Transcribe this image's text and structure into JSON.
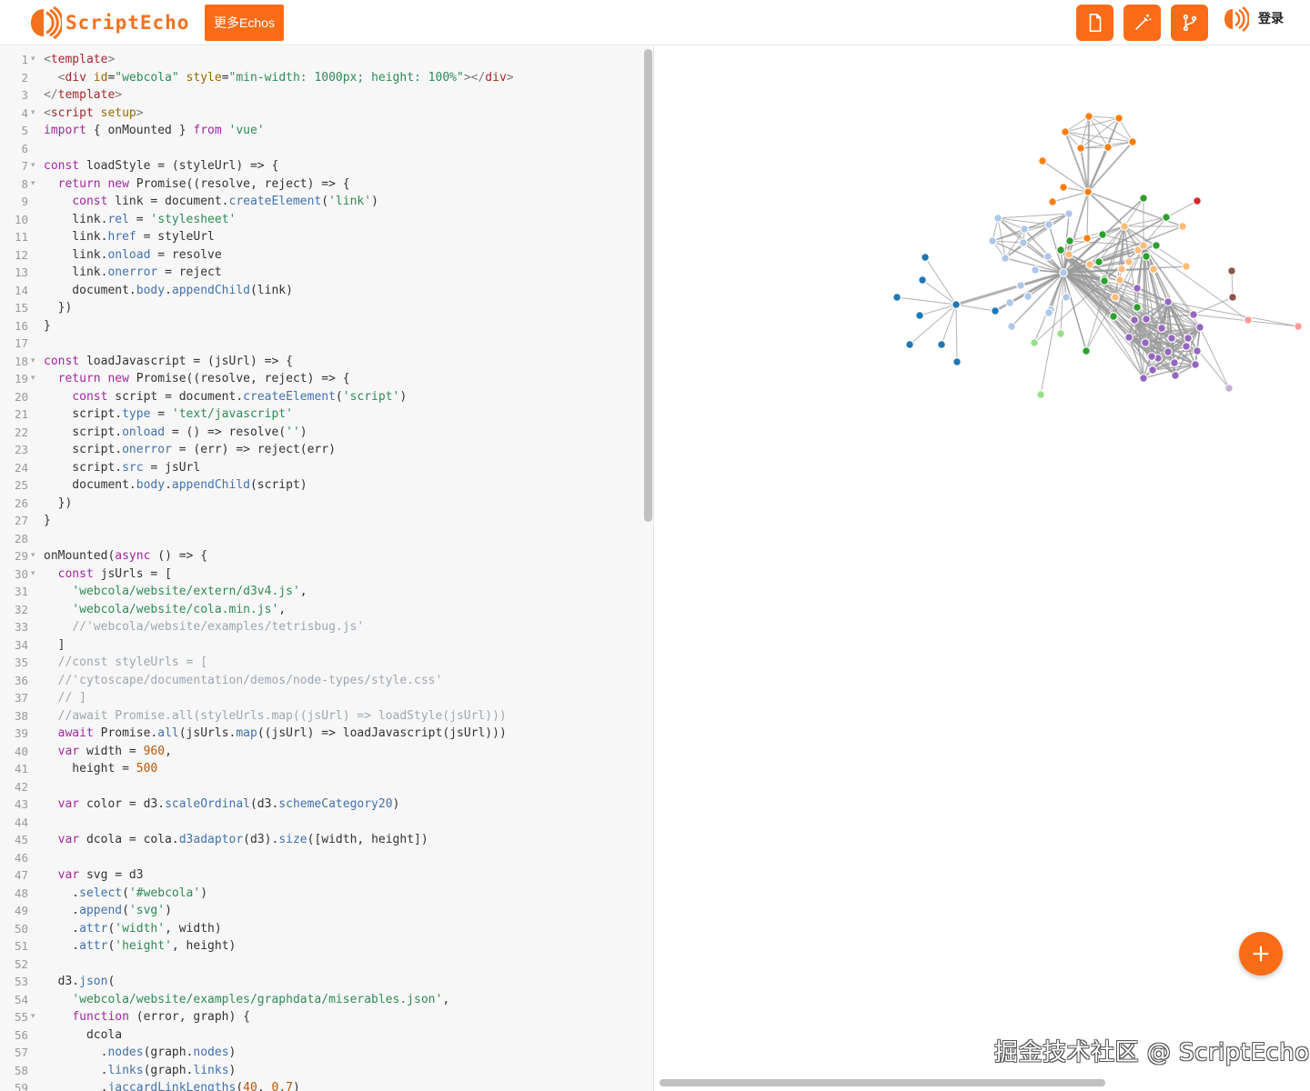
{
  "header": {
    "logo_text": "ScriptEcho",
    "more_button": "更多Echos",
    "tools": [
      {
        "icon": "file-icon"
      },
      {
        "icon": "magic-wand-icon"
      },
      {
        "icon": "branch-icon"
      }
    ],
    "login_label": "登录"
  },
  "colors": {
    "accent": "#fa6c17",
    "logo": "#f4711e"
  },
  "editor": {
    "lines": [
      [
        [
          "br",
          "<"
        ],
        [
          "tag",
          "template"
        ],
        [
          "br",
          ">"
        ]
      ],
      [
        [
          "tx",
          "  "
        ],
        [
          "br",
          "<"
        ],
        [
          "tag",
          "div"
        ],
        [
          "tx",
          " "
        ],
        [
          "attr",
          "id"
        ],
        [
          "tx",
          "="
        ],
        [
          "str",
          "\"webcola\""
        ],
        [
          "tx",
          " "
        ],
        [
          "attr",
          "style"
        ],
        [
          "tx",
          "="
        ],
        [
          "str",
          "\"min-width: 1000px; height: 100%\""
        ],
        [
          "br",
          "></"
        ],
        [
          "tag",
          "div"
        ],
        [
          "br",
          ">"
        ]
      ],
      [
        [
          "br",
          "</"
        ],
        [
          "tag",
          "template"
        ],
        [
          "br",
          ">"
        ]
      ],
      [
        [
          "br",
          "<"
        ],
        [
          "tag",
          "script"
        ],
        [
          "tx",
          " "
        ],
        [
          "attr",
          "setup"
        ],
        [
          "br",
          ">"
        ]
      ],
      [
        [
          "kw",
          "import"
        ],
        [
          "tx",
          " { onMounted } "
        ],
        [
          "kw",
          "from"
        ],
        [
          "tx",
          " "
        ],
        [
          "str",
          "'vue'"
        ]
      ],
      [],
      [
        [
          "kw",
          "const"
        ],
        [
          "tx",
          " loadStyle = (styleUrl) => {"
        ]
      ],
      [
        [
          "tx",
          "  "
        ],
        [
          "kw",
          "return"
        ],
        [
          "tx",
          " "
        ],
        [
          "kw",
          "new"
        ],
        [
          "tx",
          " Promise((resolve, reject) => {"
        ]
      ],
      [
        [
          "tx",
          "    "
        ],
        [
          "kw",
          "const"
        ],
        [
          "tx",
          " link = document."
        ],
        [
          "prop",
          "createElement"
        ],
        [
          "tx",
          "("
        ],
        [
          "str",
          "'link'"
        ],
        [
          "tx",
          ")"
        ]
      ],
      [
        [
          "tx",
          "    link."
        ],
        [
          "prop",
          "rel"
        ],
        [
          "tx",
          " = "
        ],
        [
          "str",
          "'stylesheet'"
        ]
      ],
      [
        [
          "tx",
          "    link."
        ],
        [
          "prop",
          "href"
        ],
        [
          "tx",
          " = styleUrl"
        ]
      ],
      [
        [
          "tx",
          "    link."
        ],
        [
          "prop",
          "onload"
        ],
        [
          "tx",
          " = resolve"
        ]
      ],
      [
        [
          "tx",
          "    link."
        ],
        [
          "prop",
          "onerror"
        ],
        [
          "tx",
          " = reject"
        ]
      ],
      [
        [
          "tx",
          "    document."
        ],
        [
          "prop",
          "body"
        ],
        [
          "tx",
          "."
        ],
        [
          "prop",
          "appendChild"
        ],
        [
          "tx",
          "(link)"
        ]
      ],
      [
        [
          "tx",
          "  })"
        ]
      ],
      [
        [
          "tx",
          "}"
        ]
      ],
      [],
      [
        [
          "kw",
          "const"
        ],
        [
          "tx",
          " loadJavascript = (jsUrl) => {"
        ]
      ],
      [
        [
          "tx",
          "  "
        ],
        [
          "kw",
          "return"
        ],
        [
          "tx",
          " "
        ],
        [
          "kw",
          "new"
        ],
        [
          "tx",
          " Promise((resolve, reject) => {"
        ]
      ],
      [
        [
          "tx",
          "    "
        ],
        [
          "kw",
          "const"
        ],
        [
          "tx",
          " script = document."
        ],
        [
          "prop",
          "createElement"
        ],
        [
          "tx",
          "("
        ],
        [
          "str",
          "'script'"
        ],
        [
          "tx",
          ")"
        ]
      ],
      [
        [
          "tx",
          "    script."
        ],
        [
          "prop",
          "type"
        ],
        [
          "tx",
          " = "
        ],
        [
          "str",
          "'text/javascript'"
        ]
      ],
      [
        [
          "tx",
          "    script."
        ],
        [
          "prop",
          "onload"
        ],
        [
          "tx",
          " = () => resolve("
        ],
        [
          "str",
          "''"
        ],
        [
          "tx",
          ")"
        ]
      ],
      [
        [
          "tx",
          "    script."
        ],
        [
          "prop",
          "onerror"
        ],
        [
          "tx",
          " = (err) => reject(err)"
        ]
      ],
      [
        [
          "tx",
          "    script."
        ],
        [
          "prop",
          "src"
        ],
        [
          "tx",
          " = jsUrl"
        ]
      ],
      [
        [
          "tx",
          "    document."
        ],
        [
          "prop",
          "body"
        ],
        [
          "tx",
          "."
        ],
        [
          "prop",
          "appendChild"
        ],
        [
          "tx",
          "(script)"
        ]
      ],
      [
        [
          "tx",
          "  })"
        ]
      ],
      [
        [
          "tx",
          "}"
        ]
      ],
      [],
      [
        [
          "tx",
          "onMounted("
        ],
        [
          "kw",
          "async"
        ],
        [
          "tx",
          " () => {"
        ]
      ],
      [
        [
          "tx",
          "  "
        ],
        [
          "kw",
          "const"
        ],
        [
          "tx",
          " jsUrls = ["
        ]
      ],
      [
        [
          "tx",
          "    "
        ],
        [
          "str",
          "'webcola/website/extern/d3v4.js'"
        ],
        [
          "tx",
          ","
        ]
      ],
      [
        [
          "tx",
          "    "
        ],
        [
          "str",
          "'webcola/website/cola.min.js'"
        ],
        [
          "tx",
          ","
        ]
      ],
      [
        [
          "tx",
          "    "
        ],
        [
          "cm",
          "//'webcola/website/examples/tetrisbug.js'"
        ]
      ],
      [
        [
          "tx",
          "  ]"
        ]
      ],
      [
        [
          "tx",
          "  "
        ],
        [
          "cm",
          "//const styleUrls = ["
        ]
      ],
      [
        [
          "tx",
          "  "
        ],
        [
          "cm",
          "//'cytoscape/documentation/demos/node-types/style.css'"
        ]
      ],
      [
        [
          "tx",
          "  "
        ],
        [
          "cm",
          "// ]"
        ]
      ],
      [
        [
          "tx",
          "  "
        ],
        [
          "cm",
          "//await Promise.all(styleUrls.map((jsUrl) => loadStyle(jsUrl)))"
        ]
      ],
      [
        [
          "tx",
          "  "
        ],
        [
          "kw",
          "await"
        ],
        [
          "tx",
          " Promise."
        ],
        [
          "prop",
          "all"
        ],
        [
          "tx",
          "(jsUrls."
        ],
        [
          "prop",
          "map"
        ],
        [
          "tx",
          "((jsUrl) => loadJavascript(jsUrl)))"
        ]
      ],
      [
        [
          "tx",
          "  "
        ],
        [
          "kw",
          "var"
        ],
        [
          "tx",
          " width = "
        ],
        [
          "num",
          "960"
        ],
        [
          "tx",
          ","
        ]
      ],
      [
        [
          "tx",
          "    height = "
        ],
        [
          "num",
          "500"
        ]
      ],
      [],
      [
        [
          "tx",
          "  "
        ],
        [
          "kw",
          "var"
        ],
        [
          "tx",
          " color = d3."
        ],
        [
          "prop",
          "scaleOrdinal"
        ],
        [
          "tx",
          "(d3."
        ],
        [
          "prop",
          "schemeCategory20"
        ],
        [
          "tx",
          ")"
        ]
      ],
      [],
      [
        [
          "tx",
          "  "
        ],
        [
          "kw",
          "var"
        ],
        [
          "tx",
          " dcola = cola."
        ],
        [
          "prop",
          "d3adaptor"
        ],
        [
          "tx",
          "(d3)."
        ],
        [
          "prop",
          "size"
        ],
        [
          "tx",
          "([width, height])"
        ]
      ],
      [],
      [
        [
          "tx",
          "  "
        ],
        [
          "kw",
          "var"
        ],
        [
          "tx",
          " svg = d3"
        ]
      ],
      [
        [
          "tx",
          "    ."
        ],
        [
          "prop",
          "select"
        ],
        [
          "tx",
          "("
        ],
        [
          "str",
          "'#webcola'"
        ],
        [
          "tx",
          ")"
        ]
      ],
      [
        [
          "tx",
          "    ."
        ],
        [
          "prop",
          "append"
        ],
        [
          "tx",
          "("
        ],
        [
          "str",
          "'svg'"
        ],
        [
          "tx",
          ")"
        ]
      ],
      [
        [
          "tx",
          "    ."
        ],
        [
          "prop",
          "attr"
        ],
        [
          "tx",
          "("
        ],
        [
          "str",
          "'width'"
        ],
        [
          "tx",
          ", width)"
        ]
      ],
      [
        [
          "tx",
          "    ."
        ],
        [
          "prop",
          "attr"
        ],
        [
          "tx",
          "("
        ],
        [
          "str",
          "'height'"
        ],
        [
          "tx",
          ", height)"
        ]
      ],
      [],
      [
        [
          "tx",
          "  d3."
        ],
        [
          "prop",
          "json"
        ],
        [
          "tx",
          "("
        ]
      ],
      [
        [
          "tx",
          "    "
        ],
        [
          "str",
          "'webcola/website/examples/graphdata/miserables.json'"
        ],
        [
          "tx",
          ","
        ]
      ],
      [
        [
          "tx",
          "    "
        ],
        [
          "kw",
          "function"
        ],
        [
          "tx",
          " (error, graph) {"
        ]
      ],
      [
        [
          "tx",
          "      dcola"
        ]
      ],
      [
        [
          "tx",
          "        ."
        ],
        [
          "prop",
          "nodes"
        ],
        [
          "tx",
          "(graph."
        ],
        [
          "prop",
          "nodes"
        ],
        [
          "tx",
          ")"
        ]
      ],
      [
        [
          "tx",
          "        ."
        ],
        [
          "prop",
          "links"
        ],
        [
          "tx",
          "(graph."
        ],
        [
          "prop",
          "links"
        ],
        [
          "tx",
          ")"
        ]
      ],
      [
        [
          "tx",
          "        ."
        ],
        [
          "prop",
          "jaccardLinkLengths"
        ],
        [
          "tx",
          "("
        ],
        [
          "num",
          "40"
        ],
        [
          "tx",
          ", "
        ],
        [
          "num",
          "0.7"
        ],
        [
          "tx",
          ")"
        ]
      ]
    ],
    "fold_lines": [
      1,
      4,
      7,
      8,
      18,
      19,
      29,
      30,
      55
    ]
  },
  "preview": {
    "watermark": "掘金技术社区 @ ScriptEcho",
    "fab_icon": "plus-icon"
  }
}
